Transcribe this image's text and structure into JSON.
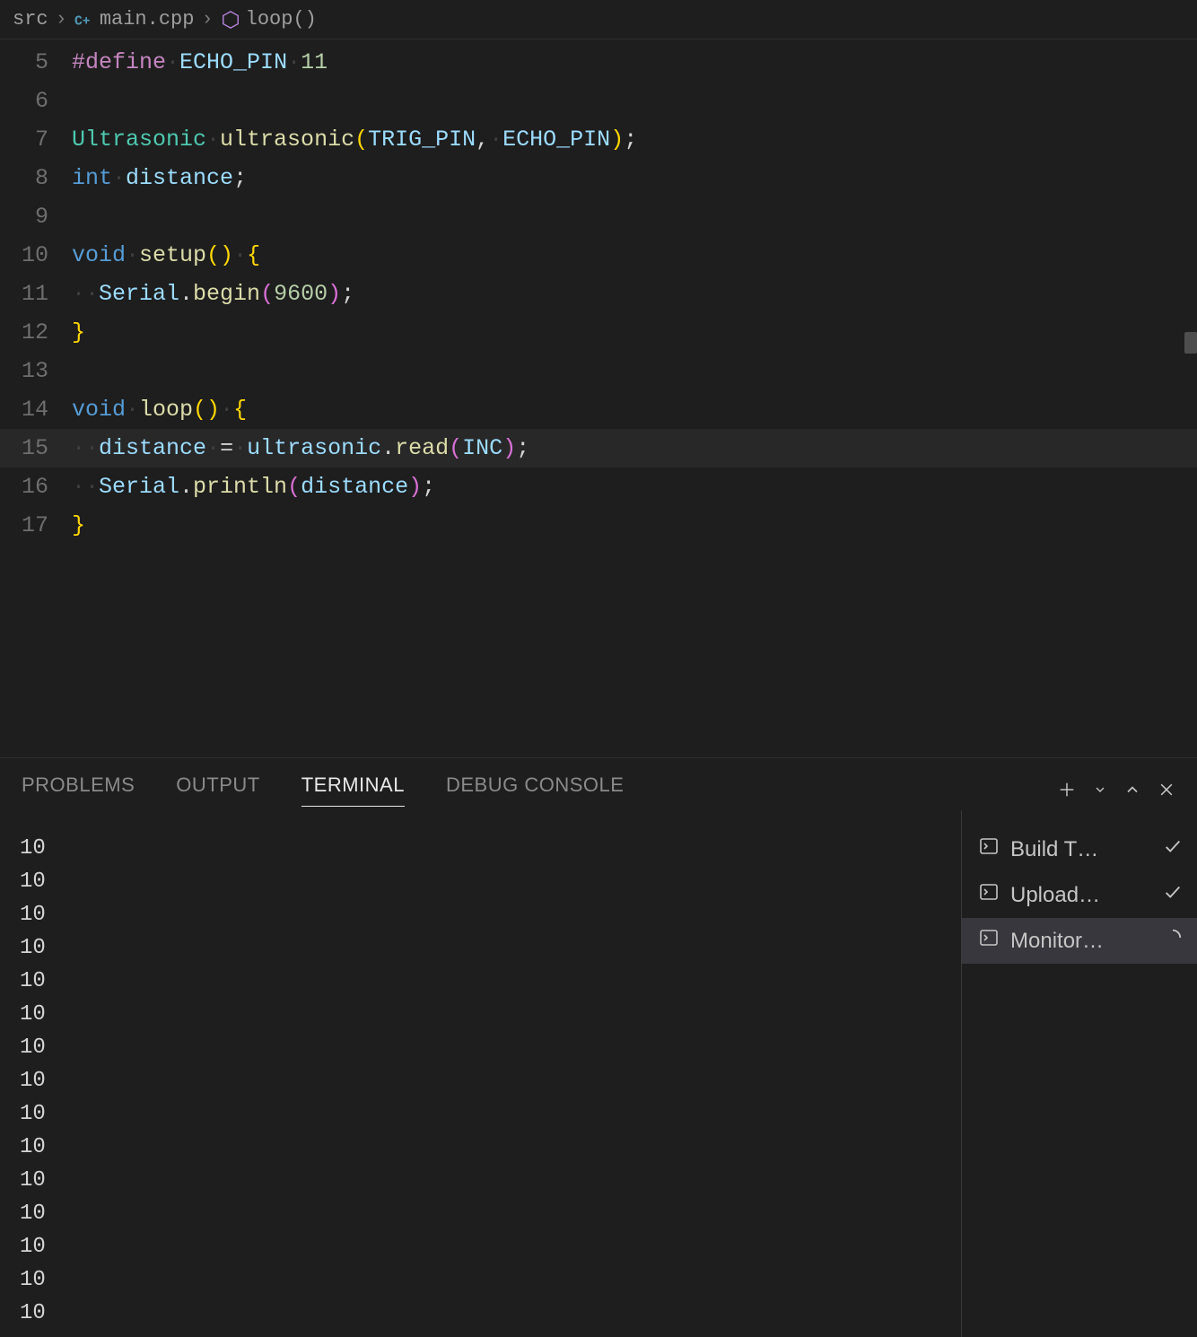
{
  "breadcrumb": {
    "folder": "src",
    "file": "main.cpp",
    "symbol": "loop()"
  },
  "code": {
    "lines": [
      {
        "n": 5,
        "tokens": [
          {
            "c": "tk-keyword",
            "t": "#define"
          },
          {
            "c": "tk-ws",
            "t": "·"
          },
          {
            "c": "tk-const",
            "t": "ECHO_PIN"
          },
          {
            "c": "tk-ws",
            "t": "·"
          },
          {
            "c": "tk-number",
            "t": "11"
          }
        ]
      },
      {
        "n": 6,
        "tokens": []
      },
      {
        "n": 7,
        "tokens": [
          {
            "c": "tk-type",
            "t": "Ultrasonic"
          },
          {
            "c": "tk-ws",
            "t": "·"
          },
          {
            "c": "tk-ident",
            "t": "ultrasonic"
          },
          {
            "c": "tk-paren",
            "t": "("
          },
          {
            "c": "tk-const",
            "t": "TRIG_PIN"
          },
          {
            "c": "tk-punct",
            "t": ","
          },
          {
            "c": "tk-ws",
            "t": "·"
          },
          {
            "c": "tk-const",
            "t": "ECHO_PIN"
          },
          {
            "c": "tk-paren",
            "t": ")"
          },
          {
            "c": "tk-punct",
            "t": ";"
          }
        ]
      },
      {
        "n": 8,
        "tokens": [
          {
            "c": "tk-blue",
            "t": "int"
          },
          {
            "c": "tk-ws",
            "t": "·"
          },
          {
            "c": "tk-var",
            "t": "distance"
          },
          {
            "c": "tk-punct",
            "t": ";"
          }
        ]
      },
      {
        "n": 9,
        "tokens": []
      },
      {
        "n": 10,
        "tokens": [
          {
            "c": "tk-blue",
            "t": "void"
          },
          {
            "c": "tk-ws",
            "t": "·"
          },
          {
            "c": "tk-ident",
            "t": "setup"
          },
          {
            "c": "tk-paren",
            "t": "()"
          },
          {
            "c": "tk-ws",
            "t": "·"
          },
          {
            "c": "tk-paren",
            "t": "{"
          }
        ]
      },
      {
        "n": 11,
        "indent": true,
        "tokens": [
          {
            "c": "tk-ws",
            "t": "··"
          },
          {
            "c": "tk-var",
            "t": "Serial"
          },
          {
            "c": "tk-punct",
            "t": "."
          },
          {
            "c": "tk-ident",
            "t": "begin"
          },
          {
            "c": "tk-paren2",
            "t": "("
          },
          {
            "c": "tk-number",
            "t": "9600"
          },
          {
            "c": "tk-paren2",
            "t": ")"
          },
          {
            "c": "tk-punct",
            "t": ";"
          }
        ]
      },
      {
        "n": 12,
        "tokens": [
          {
            "c": "tk-paren",
            "t": "}"
          }
        ]
      },
      {
        "n": 13,
        "tokens": []
      },
      {
        "n": 14,
        "tokens": [
          {
            "c": "tk-blue",
            "t": "void"
          },
          {
            "c": "tk-ws",
            "t": "·"
          },
          {
            "c": "tk-ident",
            "t": "loop"
          },
          {
            "c": "tk-paren",
            "t": "()"
          },
          {
            "c": "tk-ws",
            "t": "·"
          },
          {
            "c": "tk-paren",
            "t": "{"
          }
        ]
      },
      {
        "n": 15,
        "highlighted": true,
        "indent": true,
        "tokens": [
          {
            "c": "tk-ws",
            "t": "··"
          },
          {
            "c": "tk-var",
            "t": "distance"
          },
          {
            "c": "tk-ws",
            "t": "·"
          },
          {
            "c": "tk-punct",
            "t": "="
          },
          {
            "c": "tk-ws",
            "t": "·"
          },
          {
            "c": "tk-var",
            "t": "ultrasonic"
          },
          {
            "c": "tk-punct",
            "t": "."
          },
          {
            "c": "tk-ident",
            "t": "read"
          },
          {
            "c": "tk-paren2",
            "t": "("
          },
          {
            "c": "tk-const",
            "t": "INC"
          },
          {
            "c": "tk-paren2",
            "t": ")"
          },
          {
            "c": "tk-punct",
            "t": ";"
          }
        ]
      },
      {
        "n": 16,
        "indent": true,
        "tokens": [
          {
            "c": "tk-ws",
            "t": "··"
          },
          {
            "c": "tk-var",
            "t": "Serial"
          },
          {
            "c": "tk-punct",
            "t": "."
          },
          {
            "c": "tk-ident",
            "t": "println"
          },
          {
            "c": "tk-paren2",
            "t": "("
          },
          {
            "c": "tk-var",
            "t": "distance"
          },
          {
            "c": "tk-paren2",
            "t": ")"
          },
          {
            "c": "tk-punct",
            "t": ";"
          }
        ]
      },
      {
        "n": 17,
        "tokens": [
          {
            "c": "tk-paren",
            "t": "}"
          }
        ]
      }
    ]
  },
  "panel": {
    "tabs": [
      "PROBLEMS",
      "OUTPUT",
      "TERMINAL",
      "DEBUG CONSOLE"
    ],
    "active_tab": "TERMINAL",
    "terminal_lines": [
      "10",
      "10",
      "10",
      "10",
      "10",
      "10",
      "10",
      "10",
      "10",
      "10",
      "10",
      "10",
      "10",
      "10",
      "10"
    ],
    "tasks": [
      {
        "label": "Build  T…",
        "status": "done"
      },
      {
        "label": "Upload…",
        "status": "done"
      },
      {
        "label": "Monitor…",
        "status": "running",
        "active": true
      }
    ]
  }
}
